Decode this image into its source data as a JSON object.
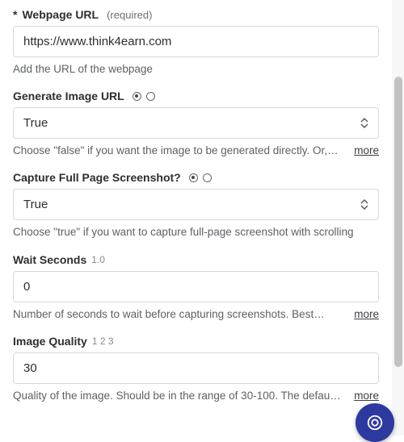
{
  "webpage_url": {
    "label": "Webpage URL",
    "required_text": "(required)",
    "value": "https://www.think4earn.com",
    "help": "Add the URL of the webpage"
  },
  "generate_image_url": {
    "label": "Generate Image URL",
    "value": "True",
    "help": "Choose \"false\" if you want the image to be generated directly. Or,…",
    "more": "more"
  },
  "capture_full_page": {
    "label": "Capture Full Page Screenshot?",
    "value": "True",
    "help": "Choose \"true\" if you want to capture full-page screenshot with scrolling"
  },
  "wait_seconds": {
    "label": "Wait Seconds",
    "annot": "1.0",
    "value": "0",
    "help": "Number of seconds to wait before capturing screenshots. Best…",
    "more": "more"
  },
  "image_quality": {
    "label": "Image Quality",
    "annot": "1 2 3",
    "value": "30",
    "help": "Quality of the image. Should be in the range of 30-100. The defau…",
    "more": "more"
  }
}
